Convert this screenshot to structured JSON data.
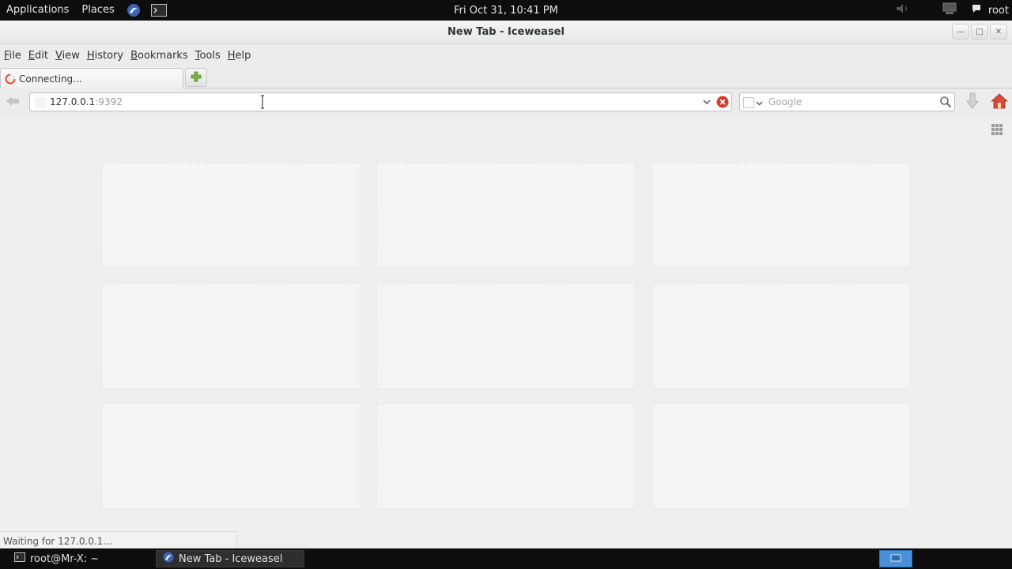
{
  "topbar": {
    "applications": "Applications",
    "places": "Places",
    "clock": "Fri Oct 31, 10:41 PM",
    "user": "root",
    "launchers": [
      "iceweasel-icon",
      "terminal-icon"
    ],
    "status_icons": [
      "volume-icon",
      "network-icon",
      "user-icon"
    ]
  },
  "window": {
    "title": "New Tab - Iceweasel"
  },
  "menubar": {
    "items": [
      {
        "first": "F",
        "rest": "ile"
      },
      {
        "first": "E",
        "rest": "dit"
      },
      {
        "first": "V",
        "rest": "iew"
      },
      {
        "first": "H",
        "rest": "istory"
      },
      {
        "first": "B",
        "rest": "ookmarks"
      },
      {
        "first": "T",
        "rest": "ools"
      },
      {
        "first": "H",
        "rest": "elp"
      }
    ]
  },
  "tabs": [
    {
      "label": "Connecting...",
      "state": "loading"
    }
  ],
  "urlbar": {
    "host": "127.0.0.1",
    "port": ":9392"
  },
  "searchbar": {
    "placeholder": "Google"
  },
  "status": {
    "text": "Waiting for 127.0.0.1..."
  },
  "taskbar": {
    "items": [
      {
        "label": "root@Mr-X: ~",
        "icon": "terminal-icon",
        "active": false
      },
      {
        "label": "New Tab - Iceweasel",
        "icon": "iceweasel-icon",
        "active": true
      }
    ]
  },
  "colors": {
    "panel": "#0d0d0d",
    "accent": "#4a90d9",
    "stop": "#d63b2a",
    "addtab": "#7bb33f"
  }
}
